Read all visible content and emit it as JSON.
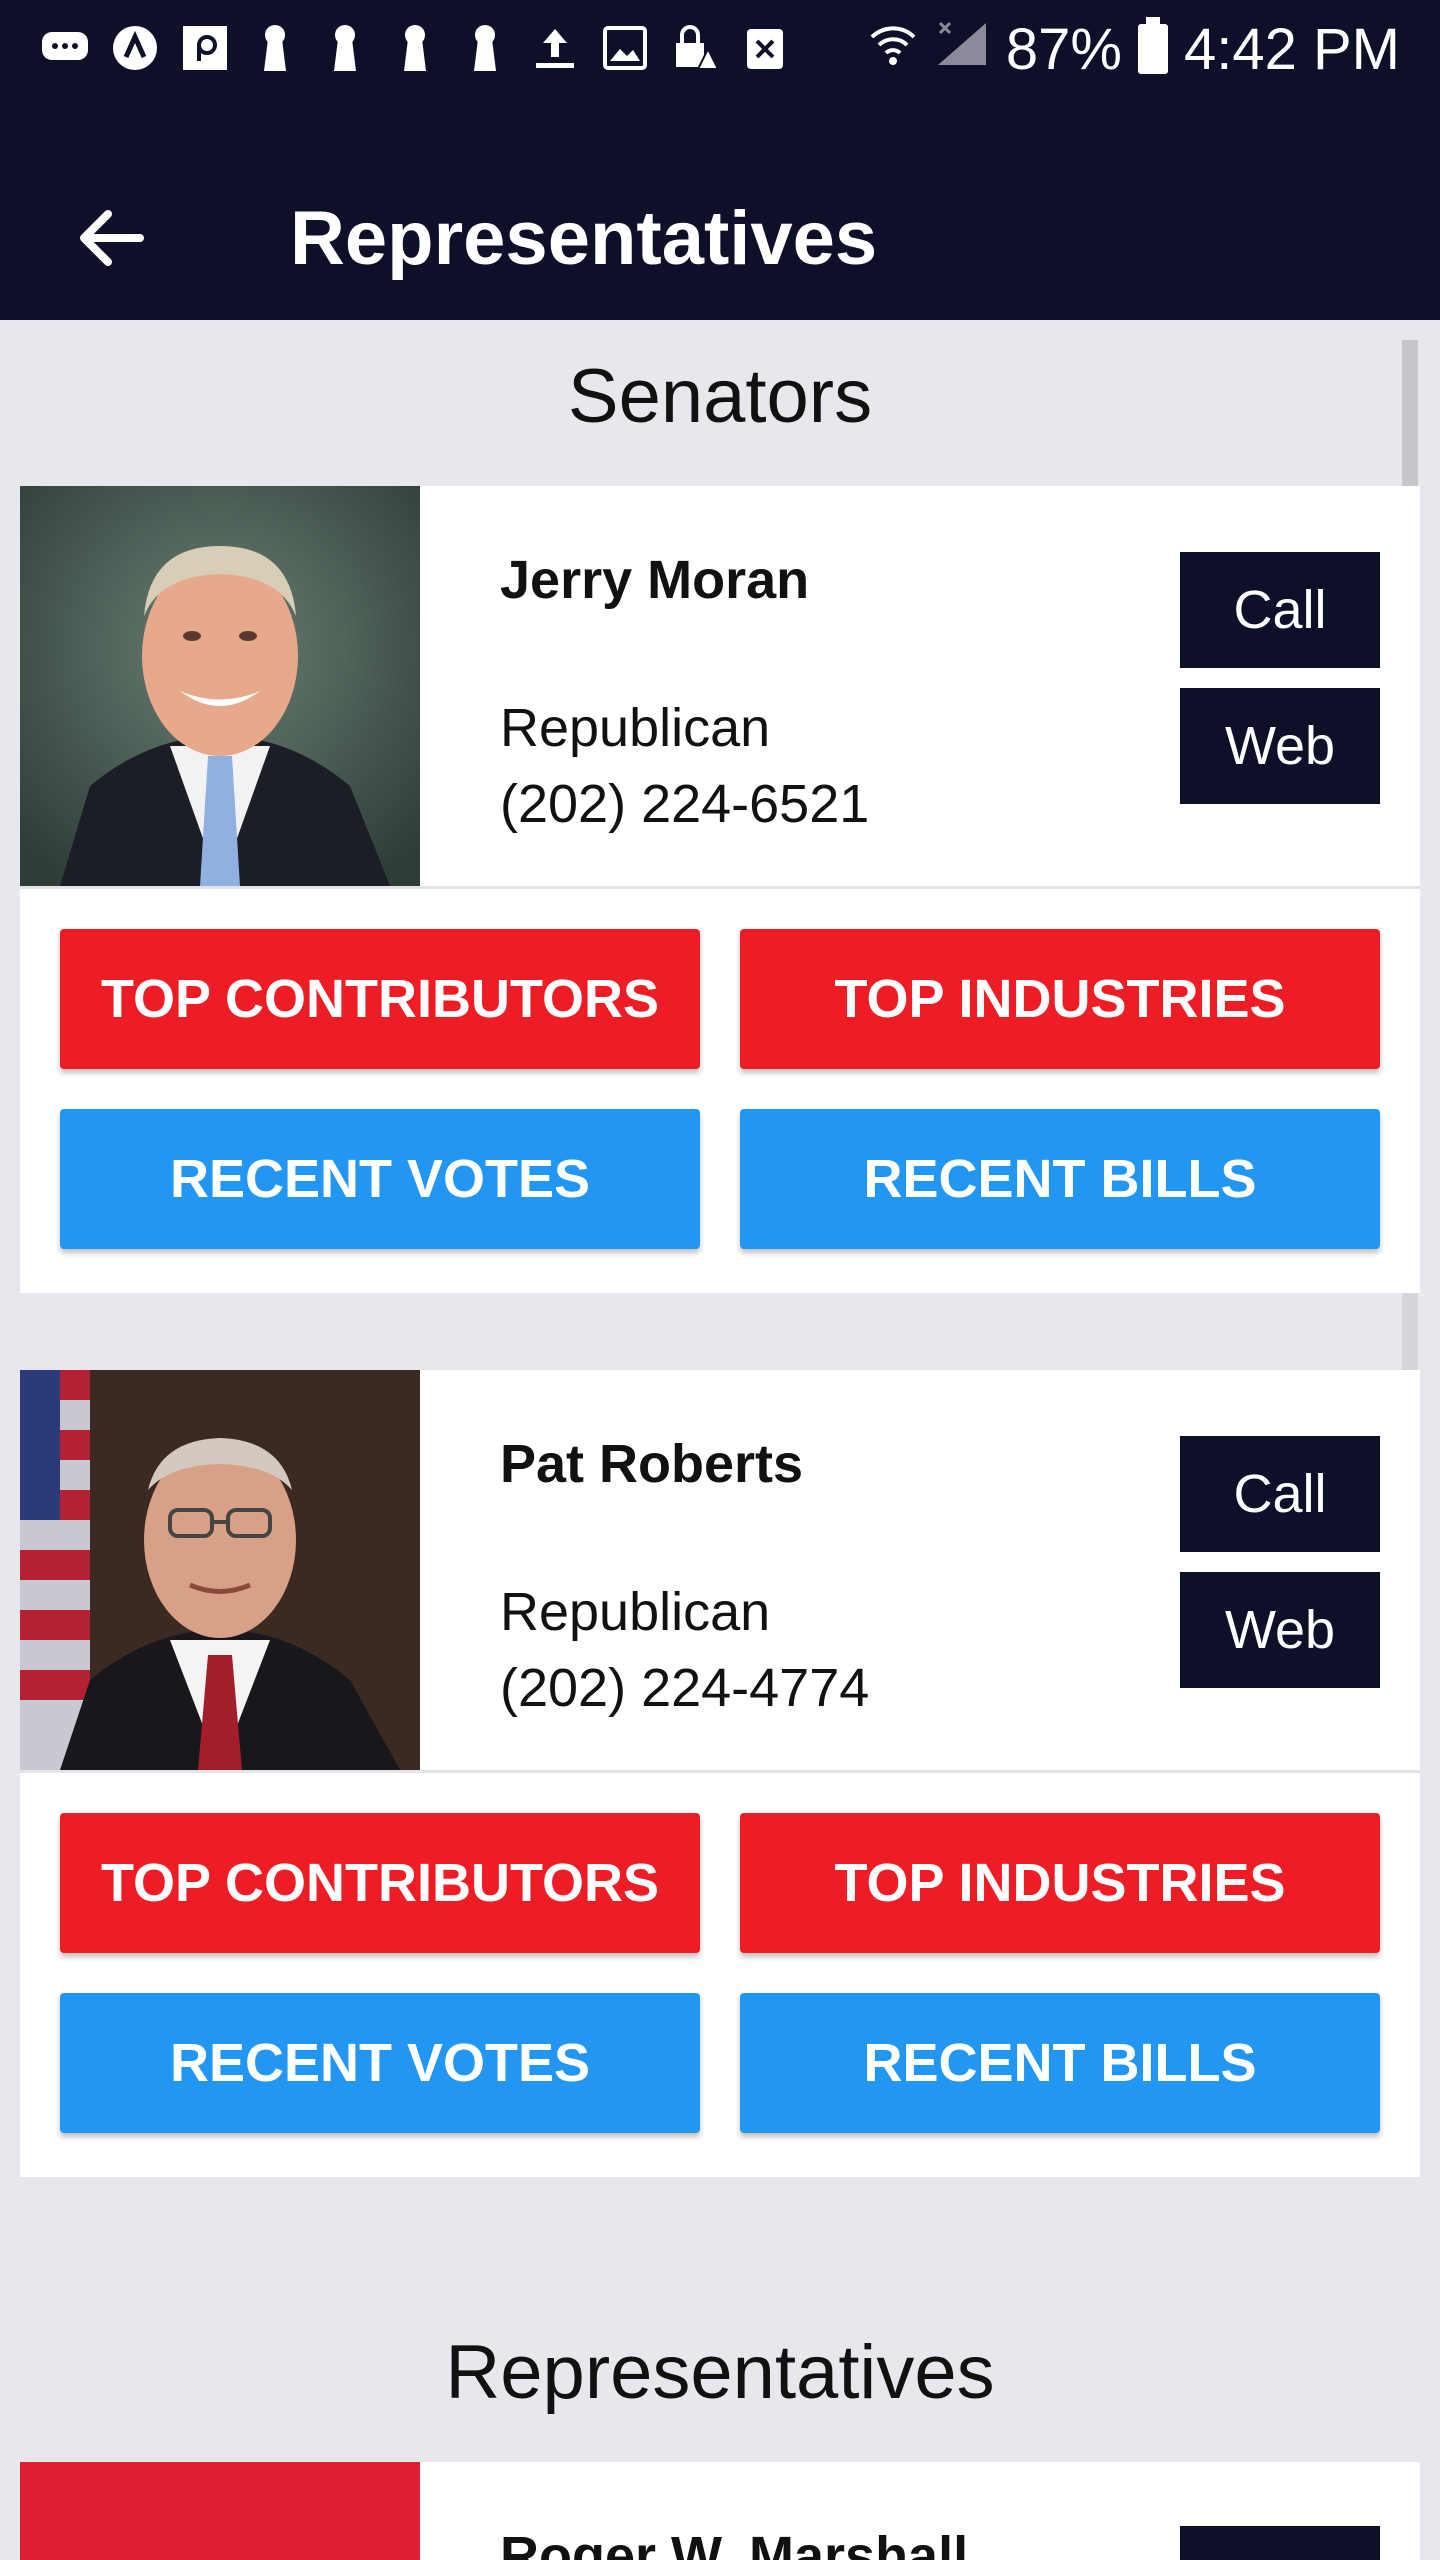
{
  "status_bar": {
    "battery": "87%",
    "time": "4:42 PM",
    "icons": [
      "messages-icon",
      "notification-icon",
      "app-icon",
      "keyhole-icon",
      "keyhole-icon",
      "keyhole-icon",
      "keyhole-icon",
      "upload-icon",
      "image-icon",
      "vpn-lock-icon",
      "close-box-icon",
      "wifi-icon",
      "no-signal-icon",
      "battery-icon"
    ]
  },
  "app_bar": {
    "title": "Representatives",
    "back_icon": "arrow-back-icon"
  },
  "sections": {
    "senators_title": "Senators",
    "representatives_title": "Representatives"
  },
  "senators": [
    {
      "name": "Jerry Moran",
      "party": "Republican",
      "phone": "(202) 224-6521",
      "call_label": "Call",
      "web_label": "Web",
      "buttons": [
        "TOP CONTRIBUTORS",
        "TOP INDUSTRIES",
        "RECENT VOTES",
        "RECENT BILLS"
      ]
    },
    {
      "name": "Pat Roberts",
      "party": "Republican",
      "phone": "(202) 224-4774",
      "call_label": "Call",
      "web_label": "Web",
      "buttons": [
        "TOP CONTRIBUTORS",
        "TOP INDUSTRIES",
        "RECENT VOTES",
        "RECENT BILLS"
      ]
    }
  ],
  "representatives": [
    {
      "name": "Roger W. Marshall"
    }
  ],
  "colors": {
    "navy": "#0e1029",
    "red": "#ee1c24",
    "blue": "#2196f3",
    "background": "#e8e7ee"
  }
}
